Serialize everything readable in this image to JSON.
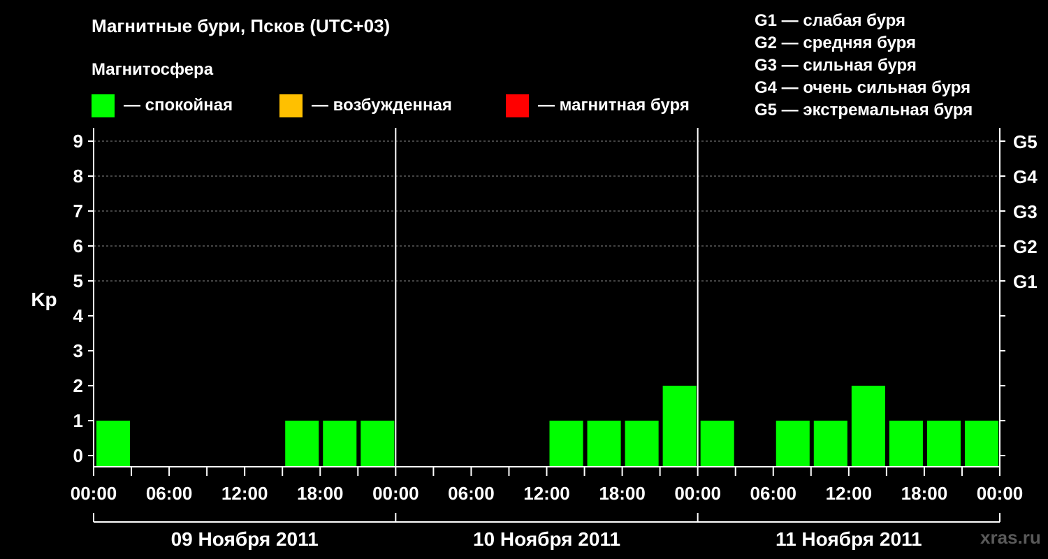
{
  "title": "Магнитные бури, Псков (UTC+03)",
  "subtitle": "Магнитосфера",
  "legend": [
    {
      "color": "#00ff00",
      "label": "— спокойная"
    },
    {
      "color": "#ffc000",
      "label": "— возбужденная"
    },
    {
      "color": "#ff0000",
      "label": "— магнитная буря"
    }
  ],
  "gscale": [
    "G1 — слабая буря",
    "G2 — средняя буря",
    "G3 — сильная буря",
    "G4 — очень сильная буря",
    "G5 — экстремальная буря"
  ],
  "watermark": "xras.ru",
  "chart_data": {
    "type": "bar",
    "ylabel": "Kp",
    "ylim": [
      0,
      9
    ],
    "yticks": [
      "0",
      "1",
      "2",
      "3",
      "4",
      "5",
      "6",
      "7",
      "8",
      "9"
    ],
    "right_labels": [
      {
        "kp": 5,
        "label": "G1"
      },
      {
        "kp": 6,
        "label": "G2"
      },
      {
        "kp": 7,
        "label": "G3"
      },
      {
        "kp": 8,
        "label": "G4"
      },
      {
        "kp": 9,
        "label": "G5"
      }
    ],
    "xtick_labels": [
      "00:00",
      "06:00",
      "12:00",
      "18:00",
      "00:00",
      "06:00",
      "12:00",
      "18:00",
      "00:00",
      "06:00",
      "12:00",
      "18:00",
      "00:00"
    ],
    "days": [
      "09 Ноября 2011",
      "10 Ноября 2011",
      "11 Ноября 2011"
    ],
    "interval_hours": 3,
    "values": [
      1,
      0,
      0,
      0,
      0,
      1,
      1,
      1,
      0,
      0,
      0,
      0,
      1,
      1,
      1,
      2,
      1,
      0,
      1,
      1,
      2,
      1,
      1,
      1
    ],
    "bar_color": "#00ff00",
    "grid_dashed_at": [
      5,
      6,
      7,
      8,
      9
    ]
  }
}
